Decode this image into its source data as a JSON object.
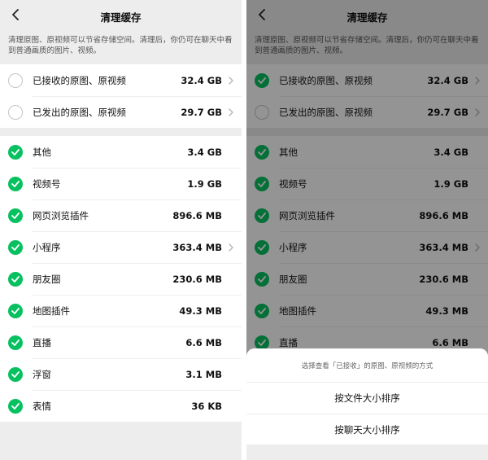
{
  "screen_left": {
    "nav": {
      "title": "清理缓存"
    },
    "description": "清理原图、原视频可以节省存储空间。清理后，你仍可在聊天中看到普通画质的图片、视频。",
    "media_rows": [
      {
        "label": "已接收的原图、原视频",
        "size": "32.4 GB",
        "checked": false,
        "has_chevron": true
      },
      {
        "label": "已发出的原图、原视频",
        "size": "29.7 GB",
        "checked": false,
        "has_chevron": true
      }
    ],
    "cache_rows": [
      {
        "label": "其他",
        "size": "3.4 GB",
        "checked": true,
        "has_chevron": false
      },
      {
        "label": "视频号",
        "size": "1.9 GB",
        "checked": true,
        "has_chevron": false
      },
      {
        "label": "网页浏览插件",
        "size": "896.6 MB",
        "checked": true,
        "has_chevron": false
      },
      {
        "label": "小程序",
        "size": "363.4 MB",
        "checked": true,
        "has_chevron": true
      },
      {
        "label": "朋友圈",
        "size": "230.6 MB",
        "checked": true,
        "has_chevron": false
      },
      {
        "label": "地图插件",
        "size": "49.3 MB",
        "checked": true,
        "has_chevron": false
      },
      {
        "label": "直播",
        "size": "6.6 MB",
        "checked": true,
        "has_chevron": false
      },
      {
        "label": "浮窗",
        "size": "3.1 MB",
        "checked": true,
        "has_chevron": false
      },
      {
        "label": "表情",
        "size": "36 KB",
        "checked": true,
        "has_chevron": false
      }
    ]
  },
  "screen_right": {
    "nav": {
      "title": "清理缓存"
    },
    "description": "清理原图、原视频可以节省存储空间。清理后，你仍可在聊天中看到普通画质的图片、视频。",
    "media_rows": [
      {
        "label": "已接收的原图、原视频",
        "size": "32.4 GB",
        "checked": true,
        "has_chevron": true
      },
      {
        "label": "已发出的原图、原视频",
        "size": "29.7 GB",
        "checked": false,
        "has_chevron": true
      }
    ],
    "cache_rows": [
      {
        "label": "其他",
        "size": "3.4 GB",
        "checked": true,
        "has_chevron": false
      },
      {
        "label": "视频号",
        "size": "1.9 GB",
        "checked": true,
        "has_chevron": false
      },
      {
        "label": "网页浏览插件",
        "size": "896.6 MB",
        "checked": true,
        "has_chevron": false
      },
      {
        "label": "小程序",
        "size": "363.4 MB",
        "checked": true,
        "has_chevron": true
      },
      {
        "label": "朋友圈",
        "size": "230.6 MB",
        "checked": true,
        "has_chevron": false
      },
      {
        "label": "地图插件",
        "size": "49.3 MB",
        "checked": true,
        "has_chevron": false
      },
      {
        "label": "直播",
        "size": "6.6 MB",
        "checked": true,
        "has_chevron": false
      }
    ],
    "action_sheet": {
      "title": "选择查看「已接收」的原图、原视频的方式",
      "options": [
        "按文件大小排序",
        "按聊天大小排序"
      ]
    }
  },
  "icons": {
    "back": "chevron-left-icon",
    "check_on": "checkmark-circle-icon",
    "check_off": "empty-circle-icon",
    "row_chevron": "chevron-right-icon"
  },
  "colors": {
    "accent_green": "#07c160",
    "page_background": "#ededed",
    "overlay": "rgba(0,0,0,0.42)"
  }
}
